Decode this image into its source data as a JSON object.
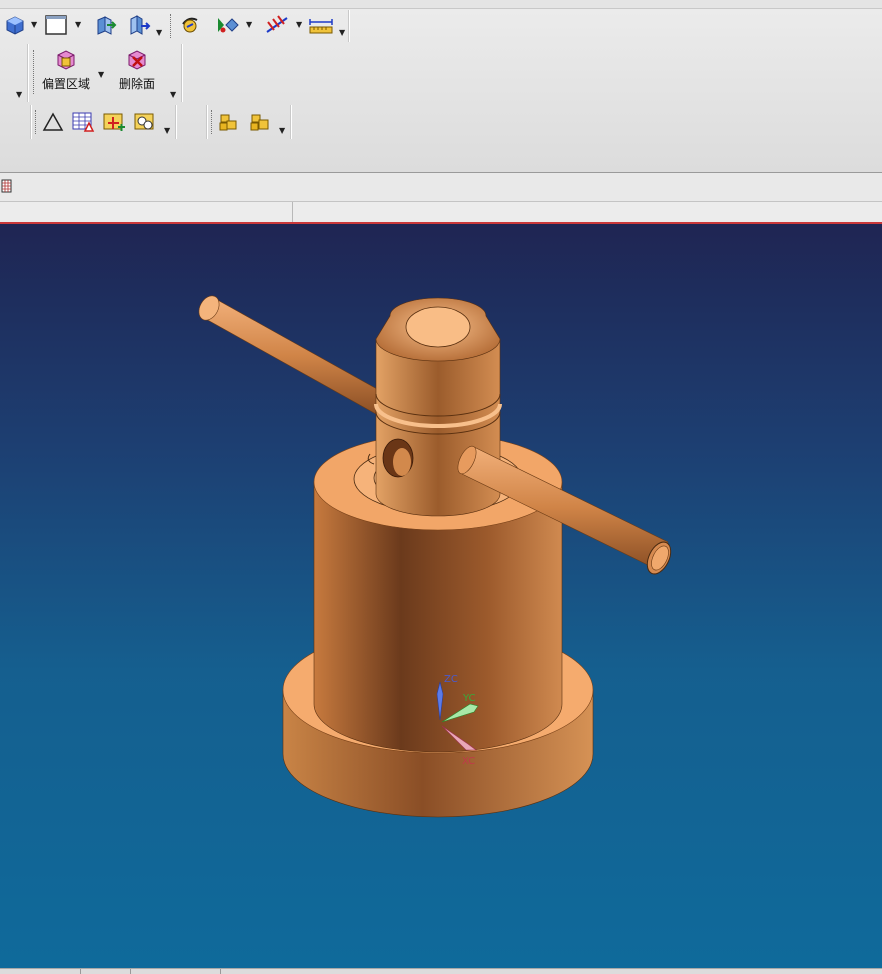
{
  "toolbar": {
    "offset_region_label": "偏置区域",
    "delete_face_label": "删除面"
  },
  "icons": {
    "view": [
      "shaded-cube-icon",
      "display-style-icon",
      "orient-view-icon",
      "section-view-icon",
      "render-style-icon",
      "snap-view-icon",
      "measure-distance-icon",
      "ruler-icon"
    ],
    "analysis": [
      "triangle-icon",
      "table-icon",
      "move-point-icon",
      "scene-objects-icon"
    ],
    "assembly": [
      "assembly-components-icon",
      "assembly-constraints-icon"
    ],
    "nav": "part-navigator-icon"
  },
  "colors": {
    "background_top": "#1f2553",
    "background_bottom": "#0f6a9b",
    "part_color": "#f2a66a",
    "tab_accent": "#c9383a"
  },
  "csys": {
    "z": "ZC",
    "y": "YC",
    "x": "XC"
  }
}
